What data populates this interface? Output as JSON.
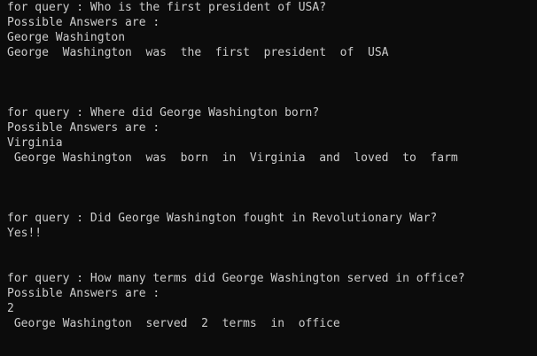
{
  "terminal": {
    "background": "#0c0c0c",
    "foreground": "#cccccc",
    "lines": [
      "for query : Who is the first president of USA?",
      "Possible Answers are :",
      "George Washington",
      "George  Washington  was  the  first  president  of  USA",
      "for query : Where did George Washington born?",
      "Possible Answers are :",
      "Virginia",
      " George Washington  was  born  in  Virginia  and  loved  to  farm",
      "for query : Did George Washington fought in Revolutionary War?",
      "Yes!!",
      "for query : How many terms did George Washington served in office?",
      "Possible Answers are :",
      "2",
      " George Washington  served  2  terms  in  office"
    ]
  }
}
